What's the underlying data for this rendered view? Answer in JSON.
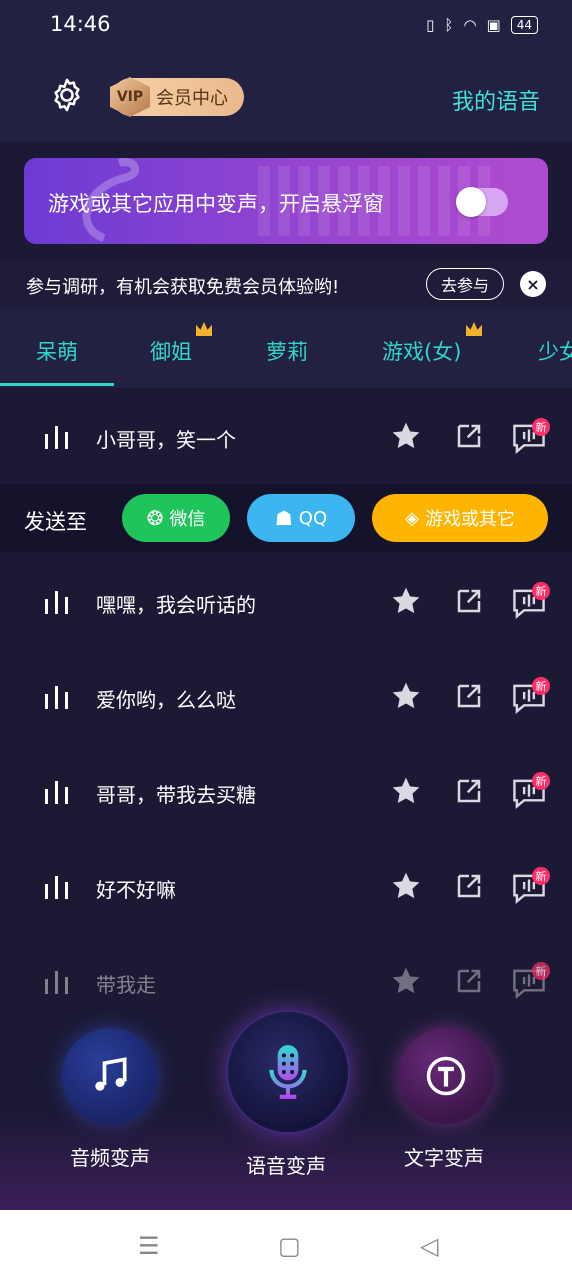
{
  "status_bar": {
    "time": "14:46",
    "battery": "44"
  },
  "header": {
    "vip_badge": "VIP",
    "vip_label": "会员中心",
    "my_voice": "我的语音"
  },
  "banner": {
    "text": "游戏或其它应用中变声，开启悬浮窗"
  },
  "survey": {
    "text": "参与调研，有机会获取免费会员体验哟!",
    "join_label": "去参与",
    "close_label": "×"
  },
  "tabs": [
    {
      "label": "呆萌",
      "active": true
    },
    {
      "label": "御姐",
      "crown": true
    },
    {
      "label": "萝莉"
    },
    {
      "label": "游戏(女)",
      "crown": true
    },
    {
      "label": "少女"
    }
  ],
  "rows": [
    {
      "text": "小哥哥，笑一个",
      "badge": "新"
    },
    {
      "text": "嘿嘿，我会听话的",
      "badge": "新"
    },
    {
      "text": "爱你哟，么么哒",
      "badge": "新"
    },
    {
      "text": "哥哥，带我去买糖",
      "badge": "新"
    },
    {
      "text": "好不好嘛",
      "badge": "新"
    },
    {
      "text": "带我走",
      "badge": "新"
    }
  ],
  "send_to": {
    "label": "发送至",
    "wechat": "微信",
    "qq": "QQ",
    "games": "游戏或其它"
  },
  "bottom": {
    "audio": "音频变声",
    "voice": "语音变声",
    "text": "文字变声"
  },
  "colors": {
    "accent": "#2fd6c9",
    "background": "#1b1934",
    "wechat": "#1fc45a",
    "qq": "#3cb6f0",
    "games": "#ffb400",
    "badge": "#ff2d6a"
  }
}
